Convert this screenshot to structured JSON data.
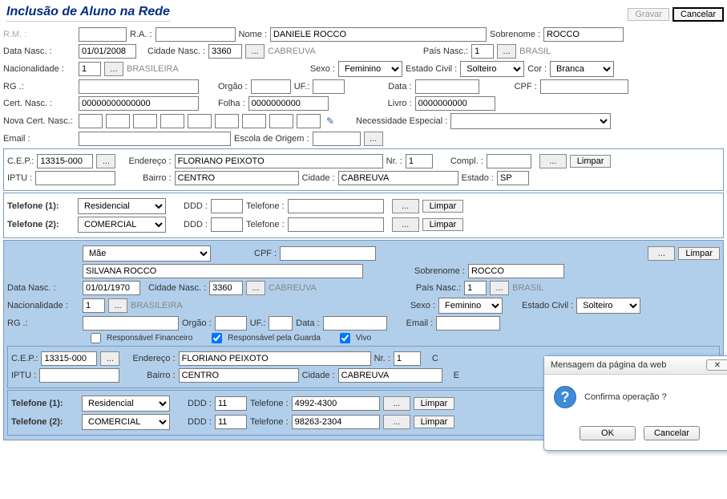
{
  "title": "Inclusão de Aluno na Rede",
  "actions": {
    "gravar": "Gravar",
    "cancelar": "Cancelar",
    "limpar": "Limpar",
    "buscar": "..."
  },
  "labels": {
    "rm": "R.M. :",
    "ra": "R.A. :",
    "nome": "Nome :",
    "sobrenome": "Sobrenome :",
    "data_nasc": "Data Nasc. :",
    "cidade_nasc": "Cidade Nasc. :",
    "pais_nasc": "País Nasc.:",
    "nacionalidade": "Nacionalidade :",
    "sexo": "Sexo :",
    "estado_civil": "Estado Civil :",
    "cor": "Cor :",
    "rg": "RG .:",
    "orgao": "Orgão :",
    "uf": "UF.:",
    "data": "Data :",
    "cpf": "CPF :",
    "cert_nasc": "Cert. Nasc. :",
    "folha": "Folha :",
    "livro": "Livro :",
    "nova_cert": "Nova Cert. Nasc.:",
    "necessidade": "Necessidade Especial :",
    "email": "Email :",
    "escola_origem": "Escola de Origem :",
    "cep": "C.E.P.:",
    "endereco": "Endereço :",
    "nr": "Nr. :",
    "compl": "Compl. :",
    "iptu": "IPTU :",
    "bairro": "Bairro :",
    "cidade": "Cidade :",
    "estado": "Estado :",
    "telefone1": "Telefone (1):",
    "telefone2": "Telefone (2):",
    "ddd": "DDD :",
    "telefone": "Telefone :",
    "resp_fin": "Responsável Financeiro",
    "resp_guarda": "Responsável pela Guarda",
    "vivo": "Vivo"
  },
  "aluno": {
    "rm": "",
    "ra": "",
    "nome": "DANIELE ROCCO",
    "sobrenome": "ROCCO",
    "data_nasc": "01/01/2008",
    "cidade_nasc_cod": "3360",
    "cidade_nasc_nome": "CABREUVA",
    "pais_nasc_cod": "1",
    "pais_nasc_nome": "BRASIL",
    "nacionalidade_cod": "1",
    "nacionalidade_nome": "BRASILEIRA",
    "sexo": "Feminino",
    "estado_civil": "Solteiro",
    "cor": "Branca",
    "rg": "",
    "orgao": "",
    "uf": "",
    "data": "",
    "cpf": "",
    "cert_nasc": "00000000000000",
    "folha": "0000000000",
    "livro": "0000000000",
    "email": "",
    "escola_origem": ""
  },
  "aluno_endereco": {
    "cep": "13315-000",
    "endereco": "FLORIANO PEIXOTO",
    "nr": "1",
    "compl": "",
    "iptu": "",
    "bairro": "CENTRO",
    "cidade": "CABREUVA",
    "estado": "SP"
  },
  "aluno_tel": {
    "t1_tipo": "Residencial",
    "t1_ddd": "",
    "t1_num": "",
    "t2_tipo": "COMERCIAL",
    "t2_ddd": "",
    "t2_num": ""
  },
  "resp": {
    "tipo": "Mãe",
    "cpf": "",
    "nome": "SILVANA ROCCO",
    "sobrenome": "ROCCO",
    "data_nasc": "01/01/1970",
    "cidade_nasc_cod": "3360",
    "cidade_nasc_nome": "CABREUVA",
    "pais_nasc_cod": "1",
    "pais_nasc_nome": "BRASIL",
    "nacionalidade_cod": "1",
    "nacionalidade_nome": "BRASILEIRA",
    "sexo": "Feminino",
    "estado_civil": "Solteiro",
    "rg": "",
    "orgao": "",
    "uf": "",
    "data": "",
    "email": "",
    "resp_fin": false,
    "resp_guarda": true,
    "vivo": true
  },
  "resp_endereco": {
    "cep": "13315-000",
    "endereco": "FLORIANO PEIXOTO",
    "nr": "1",
    "iptu": "",
    "bairro": "CENTRO",
    "cidade": "CABREUVA"
  },
  "resp_tel": {
    "t1_tipo": "Residencial",
    "t1_ddd": "11",
    "t1_num": "4992-4300",
    "t2_tipo": "COMERCIAL",
    "t2_ddd": "11",
    "t2_num": "98263-2304"
  },
  "dialog": {
    "title": "Mensagem da página da web",
    "text": "Confirma operação ?",
    "ok": "OK",
    "cancel": "Cancelar"
  }
}
